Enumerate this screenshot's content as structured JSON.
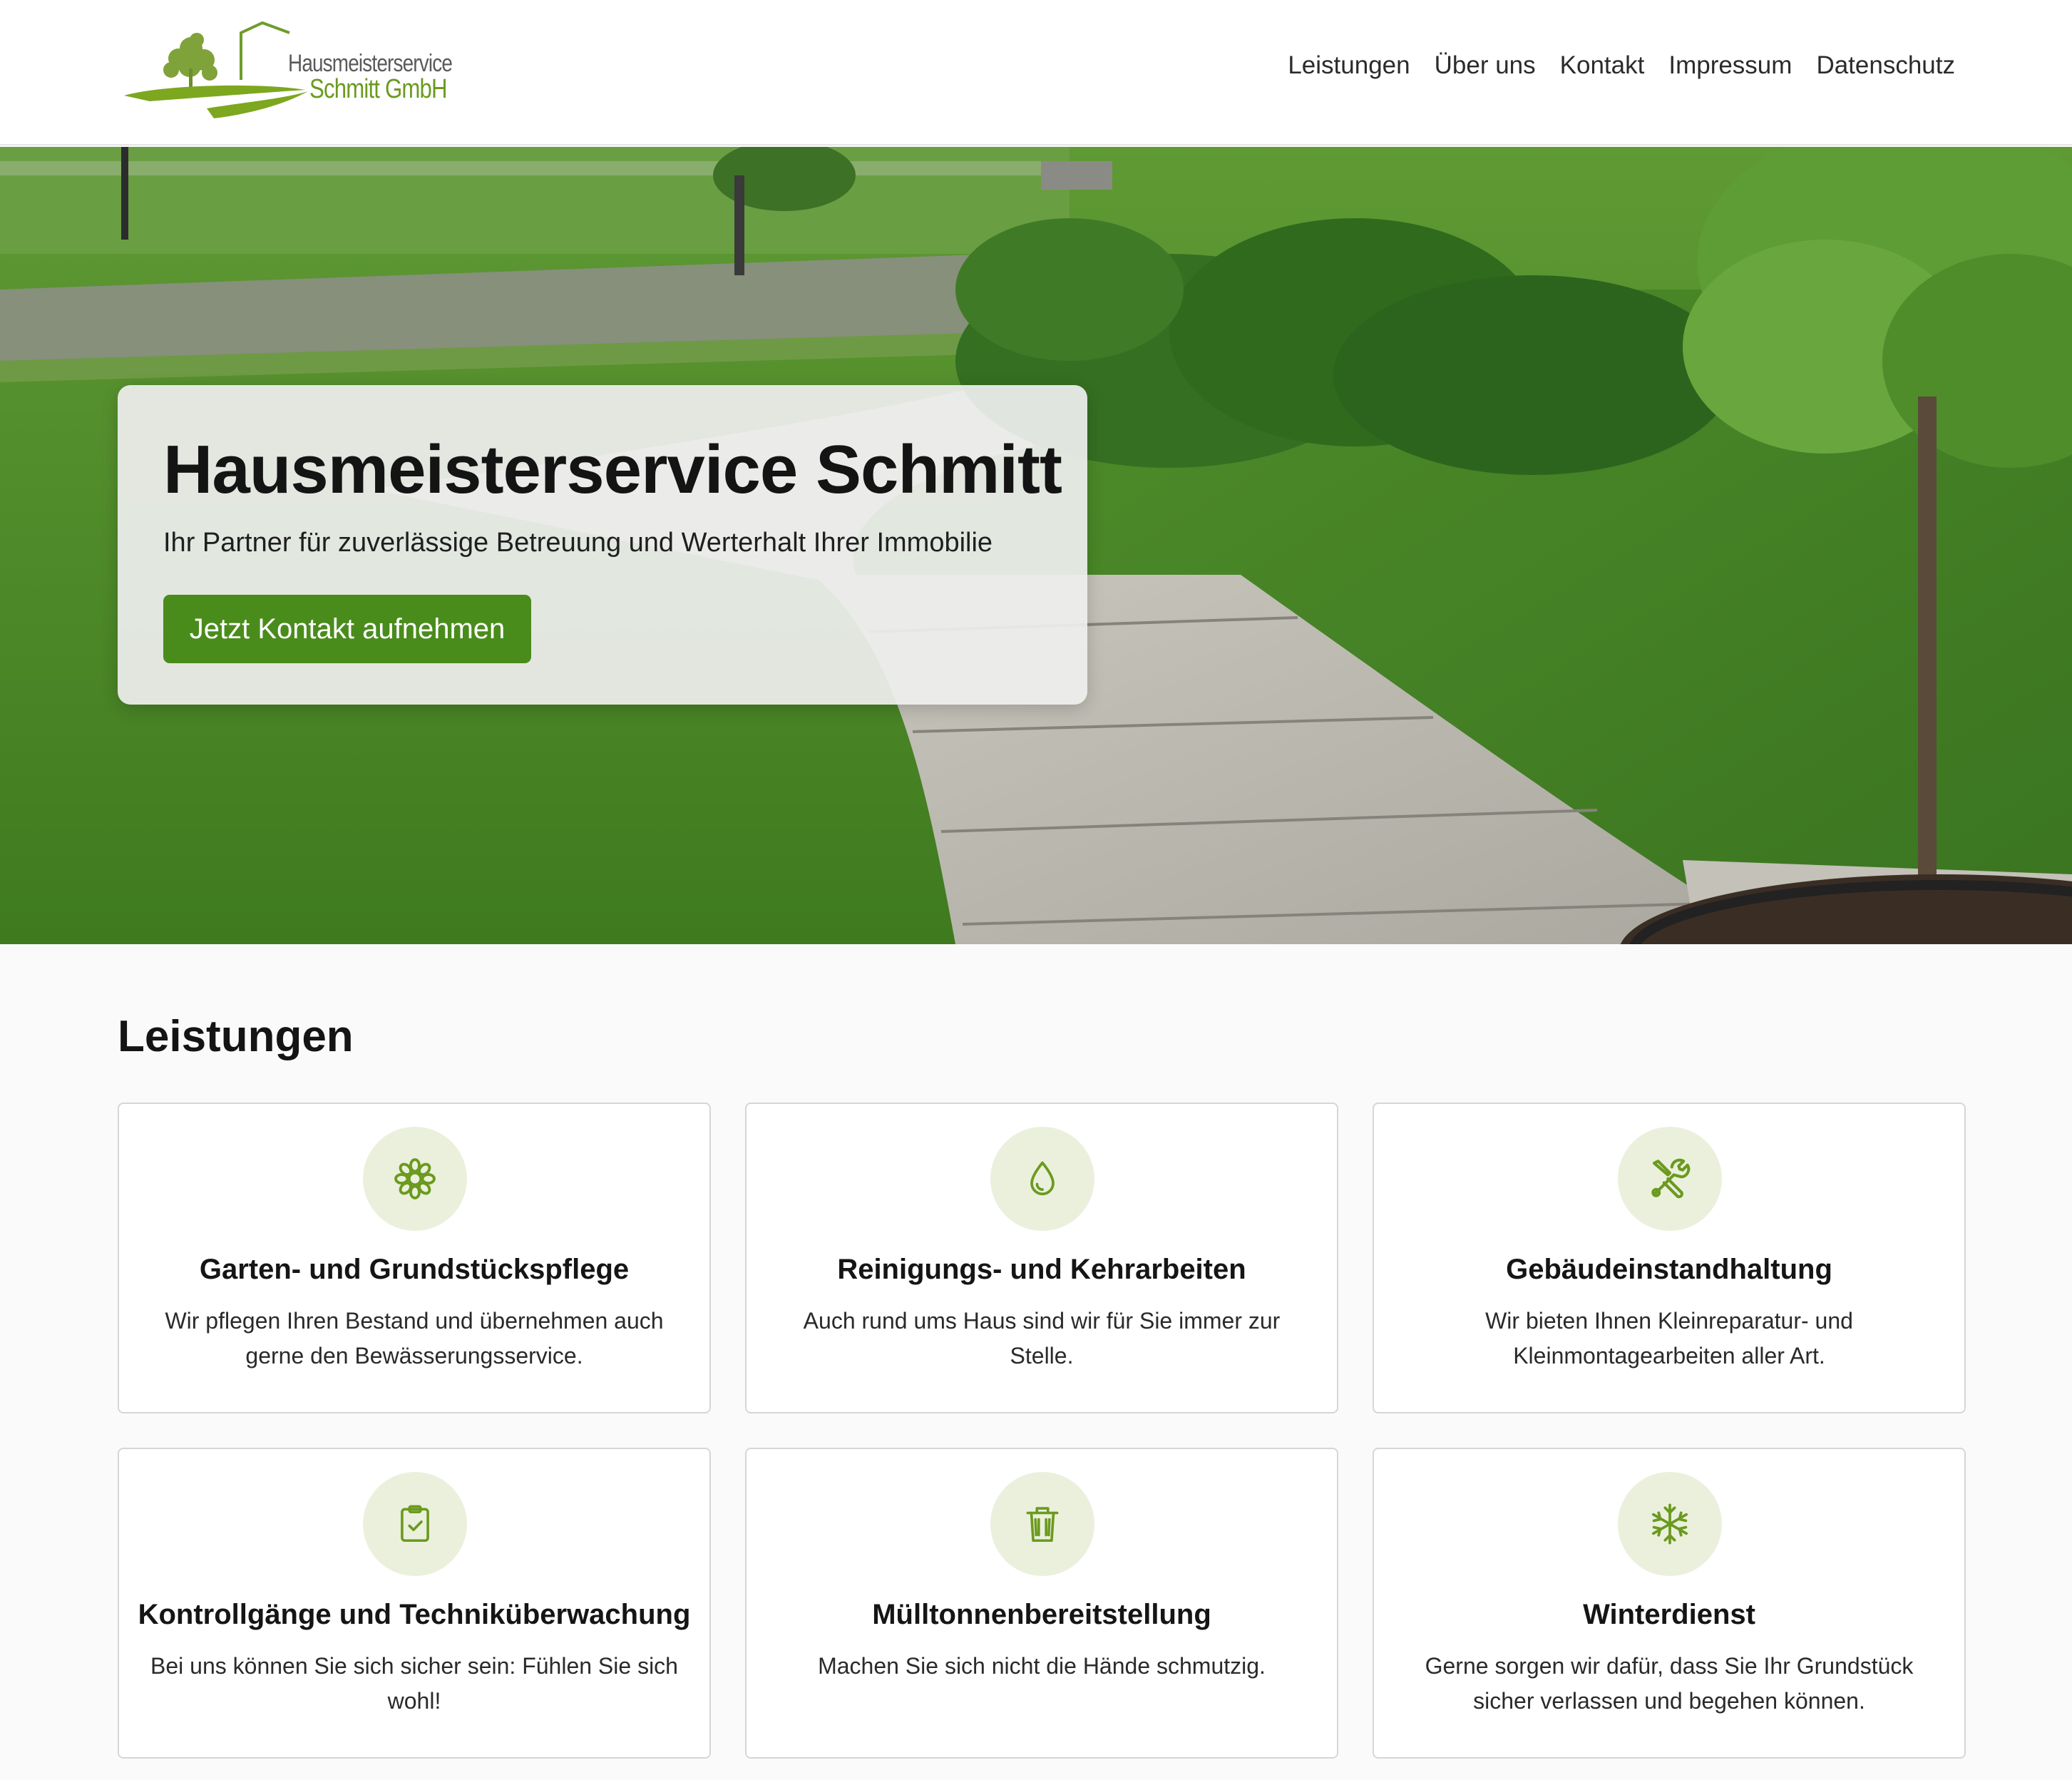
{
  "brand": {
    "line1": "Hausmeisterservice",
    "line2": "Schmitt GmbH",
    "accent_color": "#6b9a1f",
    "button_color": "#4a8c1c"
  },
  "nav": {
    "items": [
      {
        "label": "Leistungen"
      },
      {
        "label": "Über uns"
      },
      {
        "label": "Kontakt"
      },
      {
        "label": "Impressum"
      },
      {
        "label": "Datenschutz"
      }
    ]
  },
  "hero": {
    "title": "Hausmeisterservice Schmitt",
    "subtitle": "Ihr Partner für zuverlässige Betreuung und Werterhalt Ihrer Immobilie",
    "cta_label": "Jetzt Kontakt aufnehmen"
  },
  "services": {
    "heading": "Leistungen",
    "items": [
      {
        "icon": "flower-icon",
        "title": "Garten- und Grundstückspflege",
        "text": "Wir pflegen Ihren Bestand und übernehmen auch gerne den Bewässerungsservice."
      },
      {
        "icon": "droplet-icon",
        "title": "Reinigungs- und Kehrarbeiten",
        "text": "Auch rund ums Haus sind wir für Sie immer zur Stelle."
      },
      {
        "icon": "tools-icon",
        "title": "Gebäudeinstandhaltung",
        "text": "Wir bieten Ihnen Kleinreparatur- und Kleinmontagearbeiten aller Art."
      },
      {
        "icon": "clipboard-check-icon",
        "title": "Kontrollgänge und Techniküberwachung",
        "text": "Bei uns können Sie sich sicher sein: Fühlen Sie sich wohl!"
      },
      {
        "icon": "trash-icon",
        "title": "Mülltonnenbereitstellung",
        "text": "Machen Sie sich nicht die Hände schmutzig."
      },
      {
        "icon": "snowflake-icon",
        "title": "Winterdienst",
        "text": "Gerne sorgen wir dafür, dass Sie Ihr Grundstück sicher verlassen und begehen können."
      }
    ]
  }
}
